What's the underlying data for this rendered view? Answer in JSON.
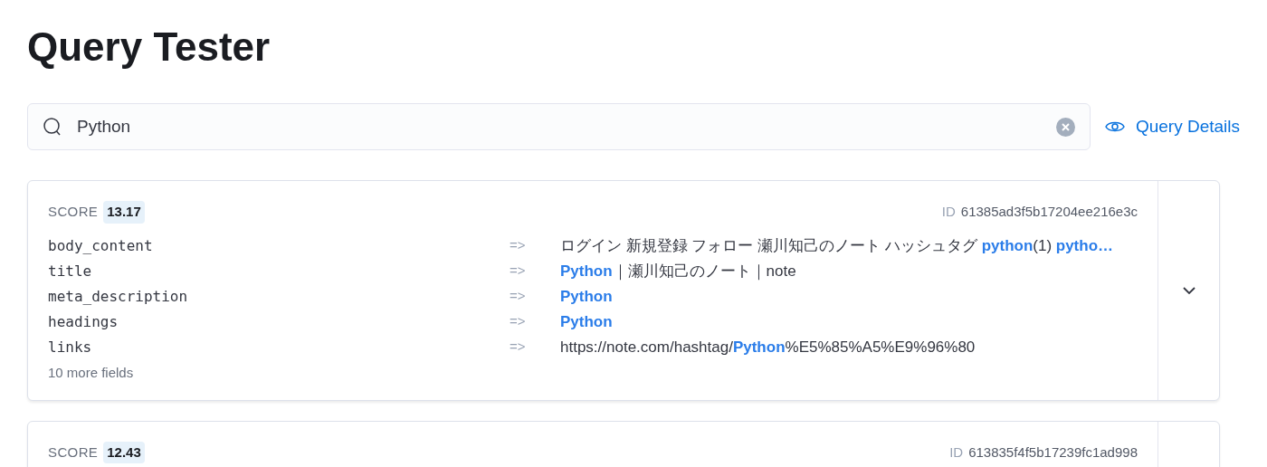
{
  "title": "Query Tester",
  "search": {
    "value": "Python"
  },
  "query_details_link": "Query Details",
  "results": [
    {
      "score_label": "SCORE",
      "score": "13.17",
      "id_label": "ID",
      "id": "61385ad3f5b17204ee216e3c",
      "fields": [
        {
          "name": "body_content",
          "arrow": "=>",
          "value": "ログイン 新規登録 フォロー 瀬川知己のノート ハッシュタグ **python**(1) **pytho…**"
        },
        {
          "name": "title",
          "arrow": "=>",
          "value": "**Python**｜瀬川知己のノート｜note"
        },
        {
          "name": "meta_description",
          "arrow": "=>",
          "value": "**Python**"
        },
        {
          "name": "headings",
          "arrow": "=>",
          "value": "**Python**"
        },
        {
          "name": "links",
          "arrow": "=>",
          "value": "https://note.com/hashtag/**Python**%E5%85%A5%E9%96%80"
        }
      ],
      "more_fields": "10 more fields"
    },
    {
      "score_label": "SCORE",
      "score": "12.43",
      "id_label": "ID",
      "id": "613835f4f5b17239fc1ad998"
    }
  ]
}
